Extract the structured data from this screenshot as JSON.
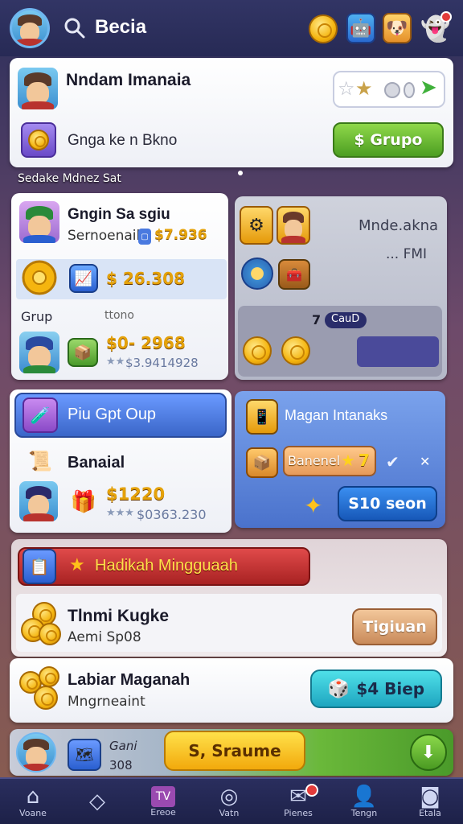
{
  "header": {
    "title": "Becia",
    "icons": [
      "profile-avatar",
      "search-icon",
      "coin-icon",
      "robot-icon",
      "pet-icon",
      "ghost-icon"
    ]
  },
  "card1": {
    "name": "Nndam Imanaia",
    "subtitle": "Gnga ke n Bkno",
    "button": "$ Grupo"
  },
  "section_label": "Sedake Mdnez Sat",
  "left_panel": {
    "title": "Gngin Sa sgiu",
    "subtitle": "Sernoenail",
    "price_tag": "$7.936",
    "row_amount": "$ 26.308",
    "group_label": "Grup",
    "group_sub": "ttono",
    "group_amount": "$0- 2968",
    "group_rating": "$3.9414928"
  },
  "right_panel": {
    "title": "Mnde.akna",
    "sub": "... FMI",
    "count": "7",
    "badge": "CauD"
  },
  "promo_left": {
    "banner": "Piu Gpt Oup",
    "item_title": "Banaial",
    "amount": "$1220",
    "rating": "$0363.230"
  },
  "promo_right": {
    "title": "Magan Intanaks",
    "badge": "Banenel",
    "badge_num": "7",
    "button": "S10 seon"
  },
  "reward": {
    "banner": "Hadikah Mingguaah",
    "title": "Tlnmi Kugke",
    "subtitle": "Aemi Sp08",
    "button": "Tigiuan"
  },
  "bonus": {
    "title": "Labiar Maganah",
    "subtitle": "Mngrneaint",
    "button": "$4 Biep"
  },
  "bottom_bar": {
    "label1": "Gani",
    "label2": "308",
    "button": "S, Sraume"
  },
  "nav": [
    {
      "label": "Voane",
      "icon": "home-icon"
    },
    {
      "label": "",
      "icon": "diamond-icon"
    },
    {
      "label": "Ereoe",
      "icon": "tv-icon"
    },
    {
      "label": "Vatn",
      "icon": "globe-icon"
    },
    {
      "label": "Pienes",
      "icon": "mail-icon"
    },
    {
      "label": "Tengn",
      "icon": "profile-icon"
    },
    {
      "label": "Etala",
      "icon": "bag-icon"
    }
  ],
  "colors": {
    "header_bg": "#2a2d5c",
    "accent_green": "#5cb82e",
    "accent_blue": "#2a6ed6",
    "accent_red": "#c43131",
    "nav_bg": "#1d2148"
  }
}
